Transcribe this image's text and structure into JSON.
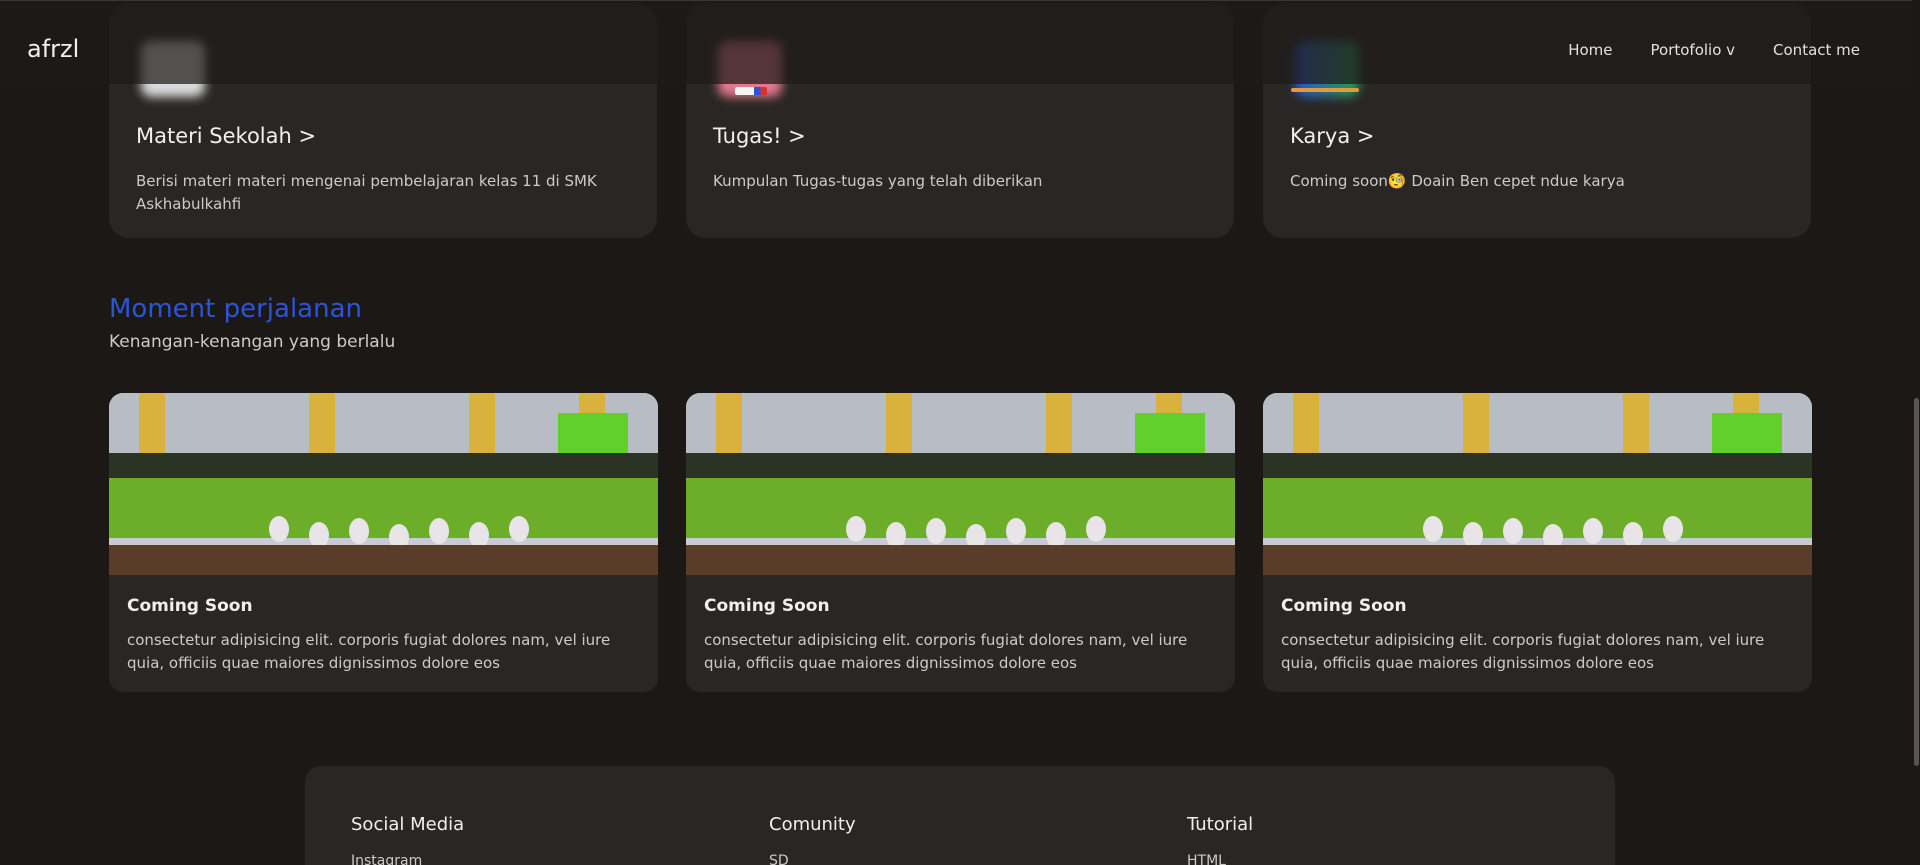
{
  "navbar": {
    "brand": "afrzl",
    "links": [
      "Home",
      "Portofolio v",
      "Contact me"
    ]
  },
  "top_cards": [
    {
      "title": "Materi Sekolah >",
      "desc": "Berisi materi materi mengenai pembelajaran kelas 11 di SMK Askhabulkahfi"
    },
    {
      "title": "Tugas! >",
      "desc": "Kumpulan Tugas-tugas yang telah diberikan"
    },
    {
      "title": "Karya >",
      "desc": "Coming soon🧐 Doain Ben cepet ndue karya"
    }
  ],
  "section": {
    "title": "Moment perjalanan",
    "subtitle": "Kenangan-kenangan yang berlalu"
  },
  "moments": [
    {
      "title": "Coming Soon",
      "desc": "consectetur adipisicing elit. corporis fugiat dolores nam, vel iure quia, officiis quae maiores dignissimos dolore eos"
    },
    {
      "title": "Coming Soon",
      "desc": "consectetur adipisicing elit. corporis fugiat dolores nam, vel iure quia, officiis quae maiores dignissimos dolore eos"
    },
    {
      "title": "Coming Soon",
      "desc": "consectetur adipisicing elit. corporis fugiat dolores nam, vel iure quia, officiis quae maiores dignissimos dolore eos"
    }
  ],
  "footer": {
    "columns": [
      {
        "heading": "Social Media",
        "item": "Instagram"
      },
      {
        "heading": "Comunity",
        "item": "SD"
      },
      {
        "heading": "Tutorial",
        "item": "HTML"
      }
    ]
  },
  "colors": {
    "background": "#1c1816",
    "card": "#2a2624",
    "accent": "#2b55d8"
  }
}
